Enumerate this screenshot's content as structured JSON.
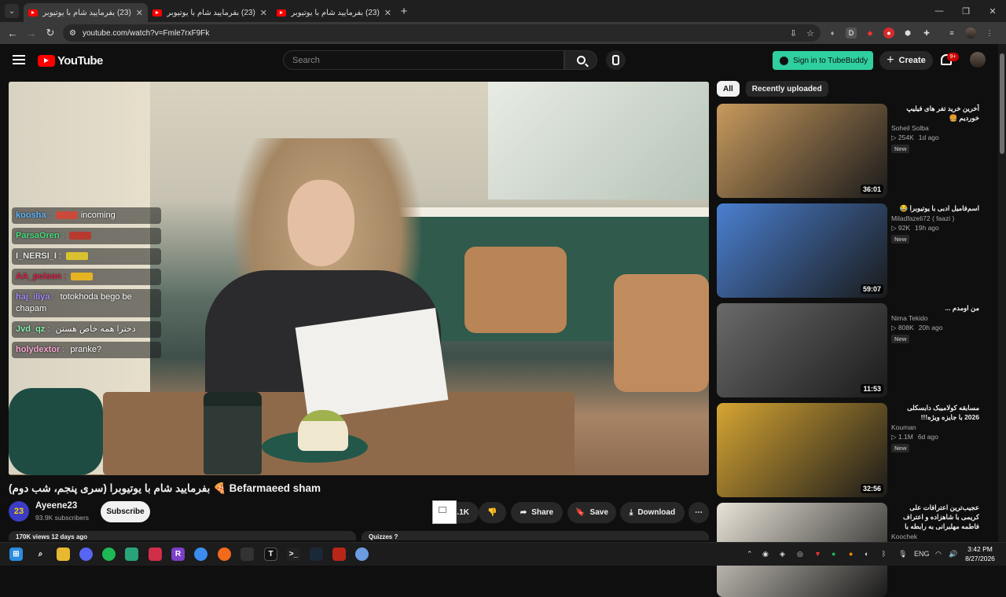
{
  "browser": {
    "tabs": [
      {
        "title": "(23) بفرمایید شام با یوتیوبرا (سری",
        "close": "✕"
      },
      {
        "title": "(23) بفرمایید شام با یوتیوبرا (سری",
        "close": "✕"
      },
      {
        "title": "(23) بفرمایید شام با یوتیوبرا (سری",
        "close": "✕"
      }
    ],
    "new_tab": "+",
    "url": "youtube.com/watch?v=Fmle7rxF9Fk"
  },
  "youtube": {
    "logo_text": "YouTube",
    "search_placeholder": "Search",
    "tubebuddy_label": "Sign in to TubeBuddy",
    "create_label": "Create",
    "notification_count": "9+"
  },
  "live_chat": [
    {
      "user": "koosha",
      "sep": " : ",
      "text": "incoming",
      "color": "#5fb6ff",
      "chip": "#c94a3a"
    },
    {
      "user": "ParsaOren",
      "sep": " : ",
      "text": "",
      "color": "#4ade80",
      "chip": "#b83a2e"
    },
    {
      "user": "I_NERSI_I",
      "sep": " : ",
      "text": "",
      "color": "#e8e8e8",
      "chip": "#d9c230"
    },
    {
      "user": "AA_poison",
      "sep": " : ",
      "text": "",
      "color": "#e0234e",
      "chip": "#e6b422"
    },
    {
      "user": "haj_iliya",
      "sep": " : ",
      "text": "totokhoda bego be chapam",
      "color": "#a78bfa",
      "chip": ""
    },
    {
      "user": "Jvd_qz",
      "sep": " : ",
      "text": "دخترا همه خاص هستن",
      "color": "#86efac",
      "chip": ""
    },
    {
      "user": "holydextor",
      "sep": " : ",
      "text": "pranke?",
      "color": "#f9a8d4",
      "chip": ""
    }
  ],
  "video": {
    "title": "بفرمایید شام با یوتیوبرا (سری پنجم، شب دوم) 🍕 Befarmaeed sham",
    "channel": "Ayeene23",
    "channel_initial": "23",
    "subscribers": "93.9K subscribers",
    "subscribe_label": "Subscribe",
    "likes": "2.1K",
    "share_label": "Share",
    "save_label": "Save",
    "download_label": "Download",
    "views_line": "170K views  12 days ago",
    "quizzes_label": "Quizzes ?"
  },
  "sidebar": {
    "chips": [
      "All",
      "Recently uploaded"
    ],
    "recommendations": [
      {
        "title": "آخرین خرید تفر های فیلیپ خوردیم 🍔",
        "channel": "Soheil Solba",
        "views": "254K",
        "age": "1d ago",
        "badge": "New",
        "duration": "36:01",
        "thumb_color": "#c89a5e"
      },
      {
        "title": "اسم‌فامیل ادبی با یوتیوبرا 😂",
        "channel": "Miladfazeli72 ( faazi )",
        "views": "92K",
        "age": "19h ago",
        "badge": "New",
        "duration": "59:07",
        "thumb_color": "#4a7fd0"
      },
      {
        "title": "من اومدم ...",
        "channel": "Nima Tekido",
        "views": "808K",
        "age": "20h ago",
        "badge": "New",
        "duration": "11:53",
        "thumb_color": "#6a6a6a"
      },
      {
        "title": "مسابقه کولامیبک دابسکلی 2026 با جایزه ویژه!!!",
        "channel": "Kouman",
        "views": "1.1M",
        "age": "6d ago",
        "badge": "New",
        "duration": "32:56",
        "thumb_color": "#d6a533"
      },
      {
        "title": "عجیب‌ترین اعترافات علی کریمی با شاهزاده و اعتراف فاطمه مهلبرانی به رابطه با علی قصری!!!",
        "channel": "Koochek",
        "views": "",
        "age": "",
        "badge": "",
        "duration": "",
        "thumb_color": "#e9e4d8"
      }
    ]
  },
  "taskbar": {
    "lang": "ENG",
    "time": "3:42 PM",
    "date": "8/27/2026"
  }
}
